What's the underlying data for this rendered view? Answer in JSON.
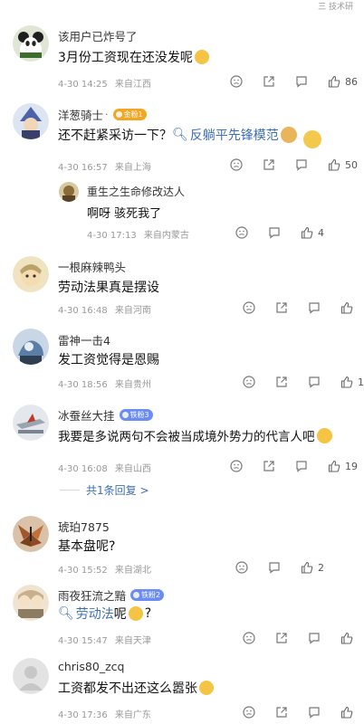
{
  "status_bar": {
    "text": "三 技术研"
  },
  "comments": [
    {
      "user": "该用户已炸号了",
      "text": "3月份工资现在还没发呢",
      "meta": {
        "date": "4-30 14:25",
        "location": "来自江西"
      },
      "likes": "86",
      "avatar_color": "#3e6b2e"
    },
    {
      "user": "洋葱骑士",
      "badge_dot": "·",
      "badge": "金粉1",
      "text": "还不赶紧采访一下？",
      "link": "反躺平先锋模范",
      "meta": {
        "date": "4-30 16:57",
        "location": "来自上海"
      },
      "likes": "50",
      "avatar_color": "#4a62a8"
    },
    {
      "user": "重生之生命修改达人",
      "text": "啊呀 骇死我了",
      "meta": {
        "date": "4-30 17:13",
        "location": "来自内蒙古"
      },
      "likes": "4",
      "avatar_color": "#8a6b3a"
    },
    {
      "user": "一根麻辣鸭头",
      "text": "劳动法果真是摆设",
      "meta": {
        "date": "4-30 16:48",
        "location": "来自河南"
      },
      "likes": "",
      "avatar_color": "#b8a46a"
    },
    {
      "user": "雷神一击4",
      "text": "发工资觉得是恩赐",
      "meta": {
        "date": "4-30 18:56",
        "location": "来自贵州"
      },
      "likes": "1",
      "avatar_color": "#5b7ea6"
    },
    {
      "user": "冰蚕丝大挂",
      "badge": "铁粉3",
      "text": "我要是多说两句不会被当成境外势力的代言人吧",
      "meta": {
        "date": "4-30 16:08",
        "location": "来自山西"
      },
      "likes": "19",
      "avatar_color": "#9aa5b0"
    },
    {
      "user": "琥珀7875",
      "text": "基本盘呢?",
      "meta": {
        "date": "4-30 15:52",
        "location": "来自湖北"
      },
      "likes": "2",
      "avatar_color": "#a0562a"
    },
    {
      "user": "雨夜狂流之黯",
      "badge": "铁粉2",
      "link": "劳动法",
      "text_after": "呢",
      "text_tail": "?",
      "meta": {
        "date": "4-30 15:47",
        "location": "来自天津"
      },
      "likes": "",
      "avatar_color": "#c8b08a"
    },
    {
      "user": "chris80_zcq",
      "text": "工资都发不出还这么嚣张",
      "meta": {
        "date": "4-30 17:36",
        "location": "来自广东"
      },
      "likes": "",
      "avatar_color": "#d9d9d9"
    }
  ],
  "replies_link": "共1条回复 >",
  "colors": {
    "link": "#3d6fb5",
    "meta": "#999999",
    "badge_blue": "#6b8df3",
    "badge_gold": "#f4a623"
  }
}
